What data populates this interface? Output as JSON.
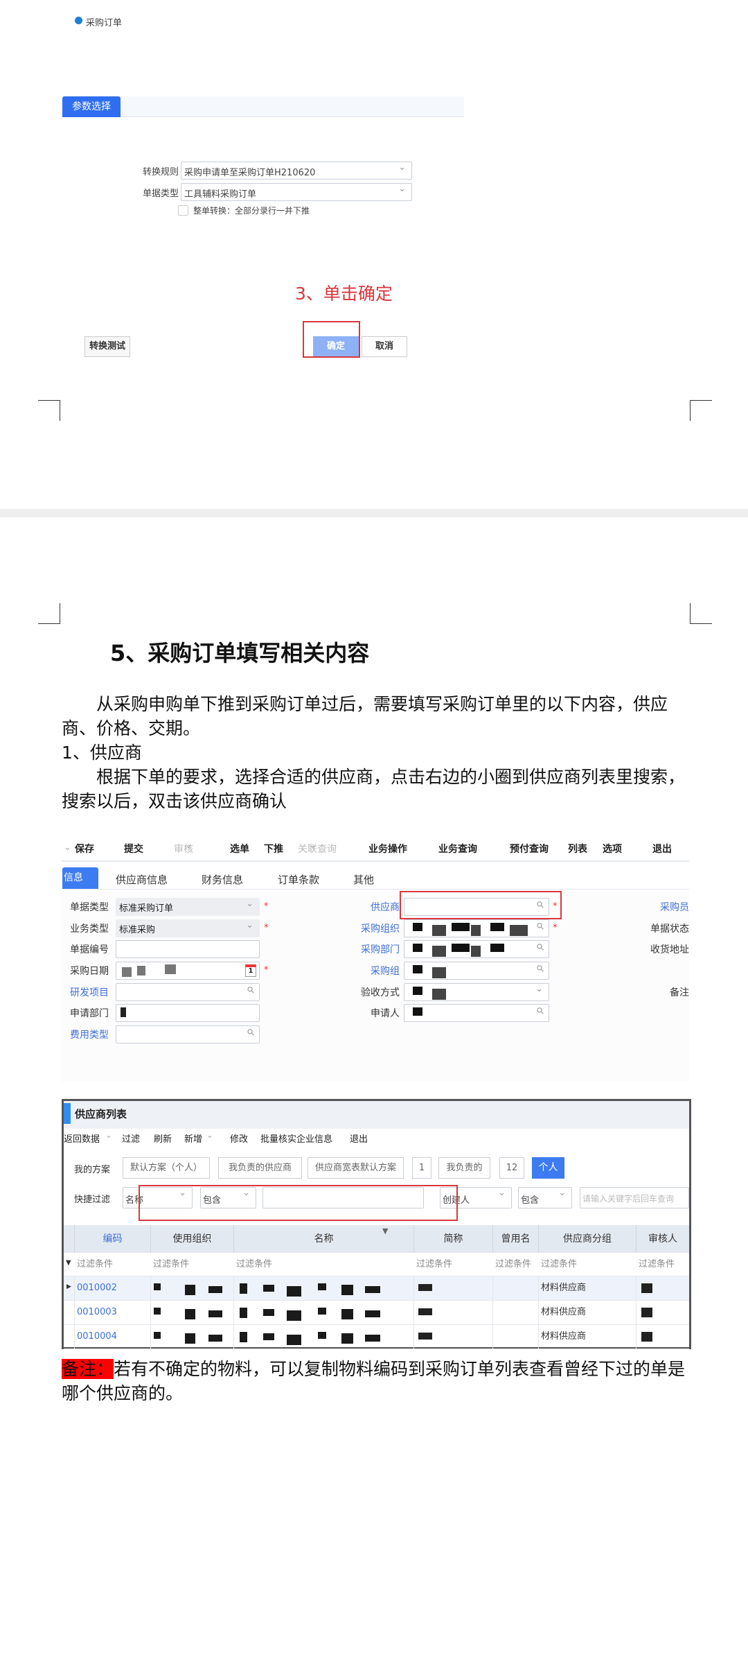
{
  "dialog": {
    "radio_label": "采购订单",
    "tab": "参数选择",
    "rule_label": "转换规则",
    "rule_value": "采购申请单至采购订单H210620",
    "type_label": "单据类型",
    "type_value": "工具辅料采购订单",
    "checkbox_label": "整单转换：全部分录行一并下推",
    "annotation": "3、单击确定",
    "test_button": "转换测试",
    "ok_button": "确定",
    "cancel_button": "取消"
  },
  "section": {
    "heading": "5、采购订单填写相关内容",
    "p1": "从采购申购单下推到采购订单过后，需要填写采购订单里的以下内容，供应商、价格、交期。",
    "item1": "1、供应商",
    "p2": "根据下单的要求，选择合适的供应商，点击右边的小圈到供应商列表里搜索，搜索以后，双击该供应商确认"
  },
  "order_form": {
    "toolbar": [
      "保存",
      "提交",
      "审核",
      "选单",
      "下推",
      "关联查询",
      "业务操作",
      "业务查询",
      "预付查询",
      "列表",
      "选项",
      "退出"
    ],
    "tabs": [
      "信息",
      "供应商信息",
      "财务信息",
      "订单条款",
      "其他"
    ],
    "left": [
      {
        "label": "单据类型",
        "value": "标准采购订单"
      },
      {
        "label": "业务类型",
        "value": "标准采购"
      },
      {
        "label": "单据编号",
        "value": ""
      },
      {
        "label": "采购日期",
        "value": ""
      },
      {
        "label": "研发项目",
        "value": ""
      },
      {
        "label": "申请部门",
        "value": ""
      },
      {
        "label": "费用类型",
        "value": ""
      }
    ],
    "middle": [
      "供应商",
      "采购组织",
      "采购部门",
      "采购组",
      "验收方式",
      "申请人"
    ],
    "right": [
      "采购员",
      "单据状态",
      "收货地址",
      "备注"
    ],
    "calendar_day": "1"
  },
  "supplier_list": {
    "title": "供应商列表",
    "toolbar": [
      "返回数据",
      "过滤",
      "刷新",
      "新增",
      "修改",
      "批量核实企业信息",
      "退出"
    ],
    "scheme_label": "我的方案",
    "schemes": [
      "默认方案（个人）",
      "我负责的供应商",
      "供应商宽表默认方案",
      "1",
      "我负责的",
      "12",
      "个人"
    ],
    "filter_label": "快捷过滤",
    "filter1_field": "名称",
    "filter1_op": "包含",
    "filter2_field": "创建人",
    "filter2_op": "包含",
    "filter2_placeholder": "请输入关键字后回车查询",
    "columns": [
      "编码",
      "使用组织",
      "名称",
      "简称",
      "曾用名",
      "供应商分组",
      "审核人"
    ],
    "filter_placeholder": "过滤条件",
    "rows": [
      {
        "code": "0010002",
        "group": "材料供应商"
      },
      {
        "code": "0010003",
        "group": "材料供应商"
      },
      {
        "code": "0010004",
        "group": "材料供应商"
      }
    ]
  },
  "note": {
    "label": "备注：",
    "text": "若有不确定的物料，可以复制物料编码到采购订单列表查看曾经下过的单是哪个供应商的。"
  }
}
